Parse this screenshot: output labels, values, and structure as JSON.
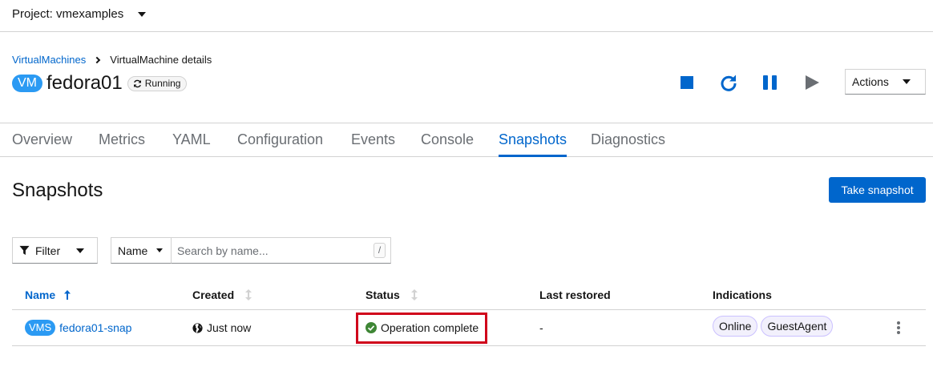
{
  "project": {
    "label": "Project: vmexamples"
  },
  "breadcrumb": {
    "parent": "VirtualMachines",
    "current": "VirtualMachine details"
  },
  "vm": {
    "badge": "VM",
    "name": "fedora01",
    "status": "Running"
  },
  "actions": {
    "label": "Actions"
  },
  "tabs": [
    {
      "label": "Overview"
    },
    {
      "label": "Metrics"
    },
    {
      "label": "YAML"
    },
    {
      "label": "Configuration"
    },
    {
      "label": "Events"
    },
    {
      "label": "Console"
    },
    {
      "label": "Snapshots",
      "active": true
    },
    {
      "label": "Diagnostics"
    }
  ],
  "section": {
    "title": "Snapshots",
    "take_snapshot": "Take snapshot"
  },
  "toolbar": {
    "filter_label": "Filter",
    "attribute": "Name",
    "search_placeholder": "Search by name...",
    "shortcut": "/"
  },
  "table": {
    "headers": {
      "name": "Name",
      "created": "Created",
      "status": "Status",
      "last_restored": "Last restored",
      "indications": "Indications"
    },
    "rows": [
      {
        "badge": "VMS",
        "name": "fedora01-snap",
        "created": "Just now",
        "status": "Operation complete",
        "last_restored": "-",
        "indications": [
          "Online",
          "GuestAgent"
        ]
      }
    ]
  },
  "colors": {
    "accent": "#0066cc",
    "badge": "#2b9af3",
    "success": "#3e8635",
    "highlight": "#d0021b"
  }
}
